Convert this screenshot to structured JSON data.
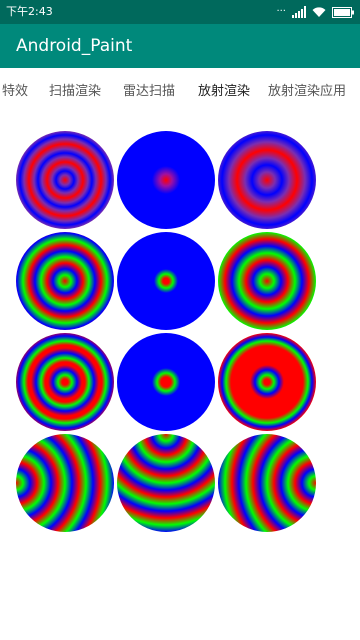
{
  "status_bar": {
    "time": "下午2:43",
    "icons": [
      "dots-icon",
      "signal-icon",
      "wifi-icon",
      "battery-icon"
    ]
  },
  "toolbar": {
    "title": "Android_Paint"
  },
  "tabs": [
    {
      "label": "特效",
      "active": false
    },
    {
      "label": "扫描渲染",
      "active": false
    },
    {
      "label": "雷达扫描",
      "active": false
    },
    {
      "label": "放射渲染",
      "active": true
    },
    {
      "label": "放射渲染应用",
      "active": false
    }
  ],
  "colors": {
    "status_bar": "#00695c",
    "toolbar": "#00897b",
    "indicator": "#e0245e",
    "red": "#ff0000",
    "green": "#00ff00",
    "blue": "#0000ff",
    "purple": "#7b2eb0"
  },
  "circles": [
    {
      "name": "radial-circle-r1c1",
      "colors": [
        "#ff0000",
        "#0000ff",
        "#7b2eb0"
      ],
      "pattern": "rings"
    },
    {
      "name": "radial-circle-r1c2",
      "colors": [
        "#ff0000",
        "#0000ff"
      ],
      "pattern": "spot"
    },
    {
      "name": "radial-circle-r1c3",
      "colors": [
        "#ff0000",
        "#0000ff",
        "#7b2eb0"
      ],
      "pattern": "rings-wide"
    },
    {
      "name": "radial-circle-r2c1",
      "colors": [
        "#ff0000",
        "#00ff00",
        "#0000ff"
      ],
      "pattern": "rings"
    },
    {
      "name": "radial-circle-r2c2",
      "colors": [
        "#ff0000",
        "#00ff00",
        "#0000ff"
      ],
      "pattern": "spot"
    },
    {
      "name": "radial-circle-r2c3",
      "colors": [
        "#ff0000",
        "#00ff00",
        "#0000ff"
      ],
      "pattern": "rings-wide"
    },
    {
      "name": "radial-circle-r3c1",
      "colors": [
        "#ff0000",
        "#00ff00",
        "#0000ff"
      ],
      "pattern": "rings-red"
    },
    {
      "name": "radial-circle-r3c2",
      "colors": [
        "#ff0000",
        "#00ff00",
        "#0000ff"
      ],
      "pattern": "spot"
    },
    {
      "name": "radial-circle-r3c3",
      "colors": [
        "#ff0000",
        "#00ff00",
        "#0000ff"
      ],
      "pattern": "rings-red-wide"
    },
    {
      "name": "radial-circle-r4c1",
      "colors": [
        "#ff0000",
        "#00ff00",
        "#0000ff"
      ],
      "pattern": "offset-left"
    },
    {
      "name": "radial-circle-r4c2",
      "colors": [
        "#ff0000",
        "#00ff00",
        "#0000ff"
      ],
      "pattern": "offset-top"
    },
    {
      "name": "radial-circle-r4c3",
      "colors": [
        "#ff0000",
        "#00ff00",
        "#0000ff"
      ],
      "pattern": "offset-right"
    }
  ]
}
